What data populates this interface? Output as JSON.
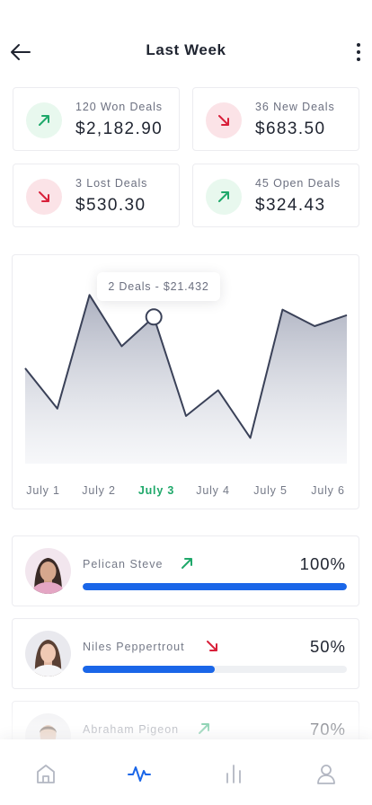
{
  "header": {
    "title": "Last Week",
    "back_icon": "arrow-left-icon",
    "more_icon": "more-vertical-icon"
  },
  "stats": [
    {
      "label": "120 Won Deals",
      "value": "$2,182.90",
      "trend": "up"
    },
    {
      "label": "36 New Deals",
      "value": "$683.50",
      "trend": "down"
    },
    {
      "label": "3 Lost Deals",
      "value": "$530.30",
      "trend": "down"
    },
    {
      "label": "45 Open Deals",
      "value": "$324.43",
      "trend": "up"
    }
  ],
  "colors": {
    "up": "#1fa86a",
    "down": "#d8203a",
    "accent": "#1a66e8",
    "chart_line": "#3a4158",
    "active_day": "#1fa86a"
  },
  "chart_data": {
    "type": "area",
    "x": [
      "July 1",
      "July 2",
      "July 3",
      "July 4",
      "July 5",
      "July 6"
    ],
    "y": [
      0.52,
      0.3,
      0.92,
      0.64,
      0.8,
      0.26,
      0.4,
      0.14,
      0.84,
      0.75,
      0.81
    ],
    "tooltip": "2 Deals - $21.432",
    "highlight_index": 4,
    "active_label": "July 3",
    "grid": false
  },
  "people": [
    {
      "name": "Pelican Steve",
      "percent": "100%",
      "progress": 1.0,
      "trend": "up"
    },
    {
      "name": "Niles Peppertrout",
      "percent": "50%",
      "progress": 0.5,
      "trend": "down"
    },
    {
      "name": "Abraham Pigeon",
      "percent": "70%",
      "progress": 0.7,
      "trend": "up"
    }
  ],
  "nav": [
    {
      "icon": "home-icon",
      "active": false
    },
    {
      "icon": "activity-icon",
      "active": true
    },
    {
      "icon": "stats-icon",
      "active": false
    },
    {
      "icon": "profile-icon",
      "active": false
    }
  ]
}
